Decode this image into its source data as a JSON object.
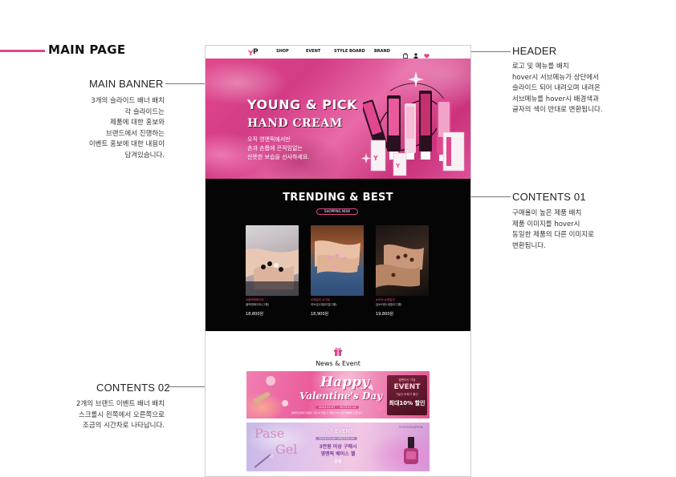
{
  "page_title": "MAIN PAGE",
  "colors": {
    "accent": "#e0478f",
    "banner_pink": "#e2478e",
    "trend_bg": "#050505"
  },
  "annotations": {
    "header": {
      "title": "HEADER",
      "lines": [
        "로고 및 메뉴를 배치",
        "hover시 서브메뉴가 상단에서",
        "슬라이드 되어 내려오며 내려온",
        "서브메뉴를 hover시 배경색과",
        "글자의 색이 반대로 변환됩니다."
      ]
    },
    "main_banner": {
      "title": "MAIN  BANNER",
      "lines": [
        "3개의 슬라이드 배너 배치",
        "각 슬라이드는",
        "제품에 대한 홍보와",
        "브랜드에서 진행하는",
        "이벤트 홍보에 대한 내용이",
        "담겨있습니다."
      ]
    },
    "contents01": {
      "title": "CONTENTS 01",
      "lines": [
        "구매율이 높은 제품 배치",
        "제품 이미지를 hover시",
        "동일한 제품의 다른 이미지로",
        "변환됩니다."
      ]
    },
    "contents02": {
      "title": "CONTENTS 02",
      "lines": [
        "2개의 브랜드 이벤트 배너 배치",
        "스크롤시 왼쪽에서 오른쪽으로",
        "조금의 시간차로 나타납니다."
      ]
    }
  },
  "mockup": {
    "header": {
      "logo_icon": "yp-logo",
      "nav": [
        "SHOP",
        "EVENT",
        "STYLE BOARD",
        "BRAND"
      ],
      "icons": [
        "bag-icon",
        "user-icon",
        "heart-icon"
      ]
    },
    "banner": {
      "title1": "YOUNG & PICK",
      "title2": "HAND CREAM",
      "copy": [
        "오직 영앤픽에서만",
        "손과 손톱에 끈적임없는",
        "산뜻한 보습을 선사하세요."
      ]
    },
    "trending": {
      "title": "TRENDING & BEST",
      "button": "SHOPPING NOW",
      "products": [
        {
          "tag": "#블랙앤화이트",
          "name": "블랙앤화이트(그룹)",
          "price": "18,800원"
        },
        {
          "tag": "#데일리 #그림",
          "name": "러브유(데일리젤그룹)",
          "price": "18,900원"
        },
        {
          "tag": "#러브 #데일리",
          "name": "딥브라운(데일리그룹)",
          "price": "19,800원"
        }
      ]
    },
    "news": {
      "icon": "gift-icon",
      "title": "News & Event",
      "event1": {
        "happy": "Happy",
        "vday": "Valentine's Day",
        "date": "2023.02.07 ~ 2023.02.14",
        "fine": "발렌타인데이 이벤트 기간 내 주문 시 최대 10% 할인 혜택을 드립니다",
        "box_line1": "발렌타인 기념",
        "box_line2": "EVENT",
        "box_line3": "7일간 초특가 할인",
        "box_line4": "최대10% 할인"
      },
      "event2": {
        "pase": "Pase",
        "gel": "Gel",
        "brand": "YOUNG&PICK",
        "headline": "기간 EVENT",
        "date": "2023.03.10~2023.03.20",
        "line1": "3만원 이상 구매시",
        "line2": "영앤픽 베이스 젤",
        "line3": "증정"
      }
    }
  }
}
